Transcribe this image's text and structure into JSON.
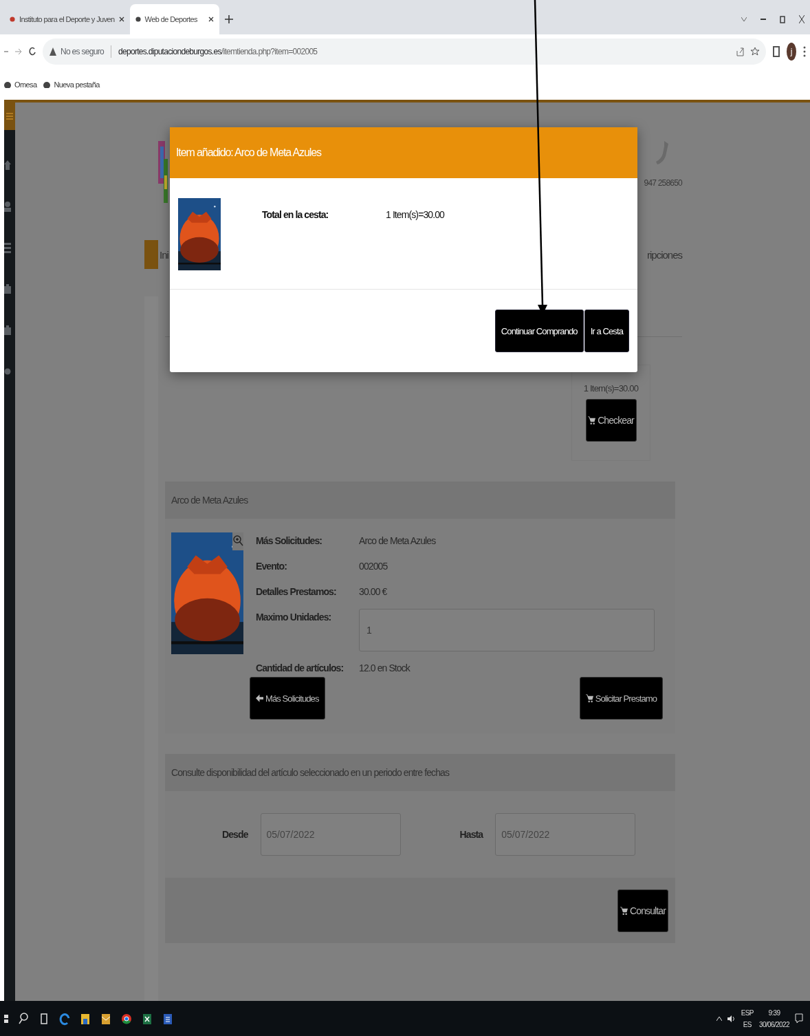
{
  "browser": {
    "tabs": [
      {
        "title": "Instituto para el Deporte y Juven",
        "selected": false
      },
      {
        "title": "Web de Deportes",
        "selected": true
      }
    ],
    "address": {
      "security": "No es seguro",
      "host": "deportes.diputaciondeburgos.es",
      "path": "/itemtienda.php?item=002005"
    },
    "profile_initial": "j",
    "bookmarks": [
      "Omesa",
      "Nueva pestaña"
    ]
  },
  "header": {
    "phone": "947 258650",
    "nav_left": "Ini",
    "nav_right": "ripciones"
  },
  "cart": {
    "summary": "1 Item(s)=30.00",
    "button": "Checkear"
  },
  "product": {
    "title": "Arco de Meta Azules",
    "fields": [
      {
        "label": "Más Solicitudes:",
        "kind": "text",
        "value": "Arco de Meta Azules"
      },
      {
        "label": "Evento:",
        "kind": "text",
        "value": "002005"
      },
      {
        "label": "Detalles Prestamos:",
        "kind": "text",
        "value": "30.00 €"
      },
      {
        "label": "Maximo Unidades:",
        "kind": "input",
        "value": "1"
      },
      {
        "label": "Cantidad de artículos:",
        "kind": "text",
        "value": "12.0 en Stock"
      }
    ],
    "back_button": "Más Solicitudes",
    "loan_button": "Solicitar Prestamo"
  },
  "availability": {
    "title": "Consulte disponibilidad del artículo seleccionado en un periodo entre fechas",
    "from_label": "Desde",
    "from_value": "05/07/2022",
    "to_label": "Hasta",
    "to_value": "05/07/2022",
    "button": "Consultar"
  },
  "modal": {
    "title": "Item añadido: Arco de Meta Azules",
    "total_label": "Total en la cesta:",
    "total_value": "1 Item(s)=30.00",
    "buttons": [
      "Continuar Comprando",
      "Ir a Cesta"
    ]
  },
  "taskbar": {
    "lang_top": "ESP",
    "lang_bottom": "ES",
    "time": "9:39",
    "date": "30/06/2022"
  }
}
